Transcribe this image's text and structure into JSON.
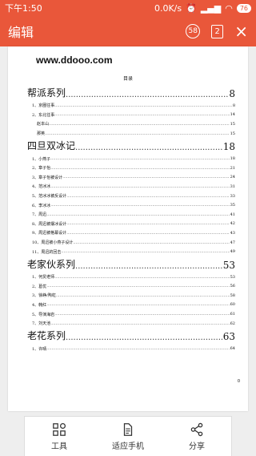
{
  "status_bar": {
    "time": "下午1:50",
    "network_speed": "0.0K/s",
    "battery": "76"
  },
  "toolbar": {
    "title": "编辑",
    "page_count_badge": "58",
    "window_badge": "2",
    "close_label": "×"
  },
  "document": {
    "site": "www.ddooo.com",
    "toc_heading": "目录",
    "trailing_zero": "0",
    "series": [
      {
        "title": "帮派系列",
        "page": "8",
        "items": [
          {
            "label": "1、京圈往事",
            "page": "8"
          },
          {
            "label": "2、东北往事",
            "page": "14"
          },
          {
            "label": "赵本山",
            "page": "15",
            "sub": true
          },
          {
            "label": "那英",
            "page": "15",
            "sub": true
          }
        ]
      },
      {
        "title": "四旦双冰记",
        "page": "18",
        "items": [
          {
            "label": "1、小燕子",
            "page": "18"
          },
          {
            "label": "2、章子怡",
            "page": "21"
          },
          {
            "label": "3、章子怡被设计",
            "page": "24"
          },
          {
            "label": "4、范冰冰",
            "page": "31"
          },
          {
            "label": "5、范冰冰被反设计",
            "page": "33"
          },
          {
            "label": "6、李冰冰",
            "page": "35"
          },
          {
            "label": "7、周迅",
            "page": "41"
          },
          {
            "label": "8、周迅被摆冰设计",
            "page": "42"
          },
          {
            "label": "9、周迅被格幕设计",
            "page": "43"
          },
          {
            "label": "10、周迅被小燕子设计",
            "page": "47"
          },
          {
            "label": "11、周迅的回击",
            "page": "49"
          }
        ]
      },
      {
        "title": "老家伙系列",
        "page": "53",
        "items": [
          {
            "label": "1、何炅老师",
            "page": "53"
          },
          {
            "label": "2、葛优",
            "page": "56"
          },
          {
            "label": "3、徐峥/陶虹",
            "page": "58"
          },
          {
            "label": "4、韩红",
            "page": "60"
          },
          {
            "label": "5、导演海岩",
            "page": "61"
          },
          {
            "label": "7、刘天池",
            "page": "62"
          }
        ]
      },
      {
        "title": "老花系列",
        "page": "63",
        "items": [
          {
            "label": "1、许晴",
            "page": "64"
          }
        ]
      }
    ]
  },
  "bottom_bar": {
    "tools_label": "工具",
    "fit_label": "适应手机",
    "share_label": "分享"
  },
  "colors": {
    "accent": "#e9573a"
  }
}
